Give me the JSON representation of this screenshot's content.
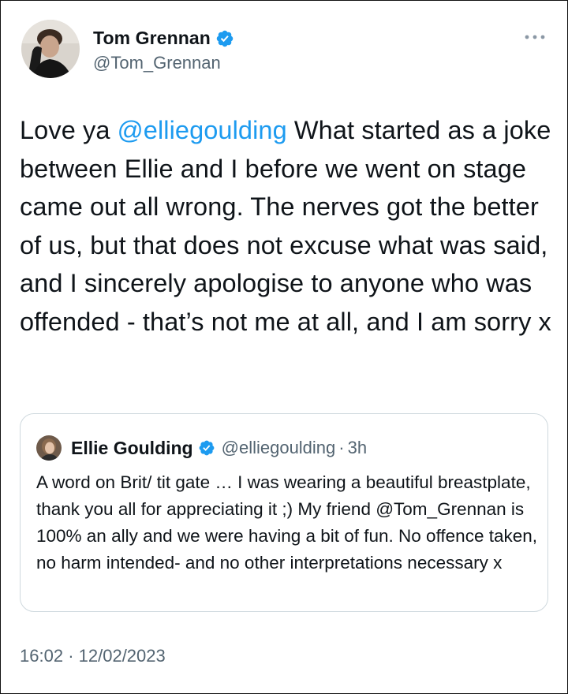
{
  "author": {
    "display_name": "Tom Grennan",
    "handle": "@Tom_Grennan",
    "avatar_icon": "profile-photo-man"
  },
  "tweet": {
    "text_segments": [
      "Love ya ",
      "@elliegoulding",
      " What started as a joke between Ellie and I before we went on stage came out all wrong. The nerves got the better of us, but that does not excuse what was said, and I sincerely apologise to anyone who was offended - that’s not me at all, and I am sorry x"
    ],
    "time": "16:02",
    "separator": "·",
    "date": "12/02/2023"
  },
  "quoted_tweet": {
    "display_name": "Ellie Goulding",
    "handle": "@elliegoulding",
    "separator": "·",
    "age": "3h",
    "text": "A word on Brit/ tit gate … I was wearing a beautiful breastplate, thank you all for appreciating it ;) My friend @Tom_Grennan is 100% an ally and we were having a bit of fun. No offence taken, no harm intended- and no other interpretations necessary x",
    "avatar_icon": "profile-photo-woman"
  },
  "colors": {
    "accent": "#1d9bf0",
    "text": "#0f1419",
    "secondary": "#536471",
    "border": "#cfd9de"
  },
  "icons": {
    "verified": "verified-badge-icon",
    "more": "more-options-icon"
  }
}
